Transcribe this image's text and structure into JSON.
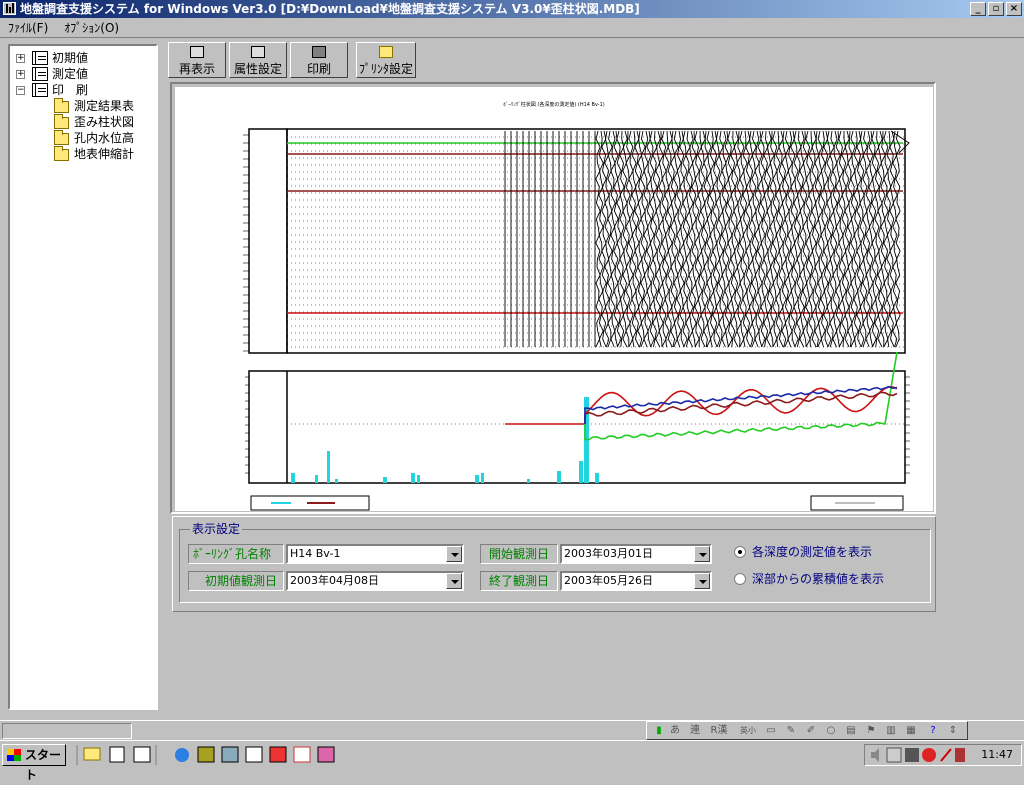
{
  "window": {
    "title": "地盤調査支援システム for Windows Ver3.0 [D:¥DownLoad¥地盤調査支援システム V3.0¥歪柱状図.MDB]",
    "controls": [
      "_",
      "▫",
      "×"
    ]
  },
  "menu": [
    "ﾌｧｲﾙ(F)",
    "ｵﾌﾟｼｮﾝ(O)"
  ],
  "tree": {
    "nodes": [
      {
        "label": "初期値",
        "expander": "+"
      },
      {
        "label": "測定値",
        "expander": "+"
      },
      {
        "label": "印　刷",
        "expander": "−"
      }
    ],
    "children": [
      "測定結果表",
      "歪み柱状図",
      "孔内水位高",
      "地表伸縮計"
    ]
  },
  "toolbar": {
    "redisplay": "再表示",
    "attr": "属性設定",
    "print": "印刷",
    "printer": "ﾌﾟﾘﾝﾀ設定"
  },
  "preview": {
    "chart_title": "ﾎﾞｰﾘﾝｸﾞ柱状図 (各深度の測定値) (H14 Bv-1)",
    "colors": {
      "green": "#22cc22",
      "red": "#cc1111",
      "darkred": "#8b1a1a",
      "blue": "#1a2aa8",
      "cyan": "#22d3e0"
    }
  },
  "settings": {
    "group_title": "表示設定",
    "boring_label": "ﾎﾞｰﾘﾝｸﾞ孔名称",
    "boring_value": "H14 Bv-1",
    "start_label": "開始観測日",
    "start_value": "2003年03月01日",
    "init_label": "初期値観測日",
    "init_value": "2003年04月08日",
    "end_label": "終了観測日",
    "end_value": "2003年05月26日",
    "radio1": "各深度の測定値を表示",
    "radio2": "深部からの累積値を表示"
  },
  "ime": {
    "a": "あ",
    "ren": "連",
    "r": "R漢",
    "eisho": "英小"
  },
  "taskbar": {
    "start": "スタート",
    "clock": "11:47"
  }
}
